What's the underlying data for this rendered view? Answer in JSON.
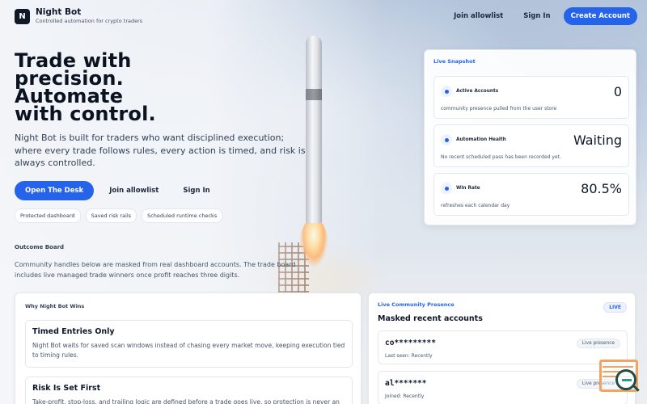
{
  "header": {
    "logo_glyph": "N",
    "brand_name": "Night Bot",
    "tagline": "Controlled automation for crypto traders",
    "nav_allowlist": "Join allowlist",
    "nav_signin": "Sign In",
    "create_account": "Create Account"
  },
  "hero": {
    "title_line1": "Trade with",
    "title_line2": "precision.",
    "title_line3": "Automate",
    "title_line4": "with control.",
    "subtitle": "Night Bot is built for traders who want disciplined execution; where every trade follows rules, every action is timed, and risk is always controlled.",
    "cta_primary": "Open The Desk",
    "cta_allowlist": "Join allowlist",
    "cta_signin": "Sign In",
    "chips": [
      "Protected dashboard",
      "Saved risk rails",
      "Scheduled runtime checks"
    ]
  },
  "outcome": {
    "label": "Outcome Board",
    "description": "Community handles below are masked from real dashboard accounts. The trade board includes live managed trade winners once profit reaches three digits."
  },
  "snapshot": {
    "title": "Live Snapshot",
    "metrics": [
      {
        "label": "Active Accounts",
        "value": "0",
        "note": "community presence pulled from the user store"
      },
      {
        "label": "Automation Health",
        "value": "Waiting",
        "note": "No recent scheduled pass has been recorded yet."
      },
      {
        "label": "Win Rate",
        "value": "80.5%",
        "note": "refreshes each calendar day"
      }
    ]
  },
  "why": {
    "title": "Why Night Bot Wins",
    "reasons": [
      {
        "title": "Timed Entries Only",
        "text": "Night Bot waits for saved scan windows instead of chasing every market move, keeping execution tied to timing rules."
      },
      {
        "title": "Risk Is Set First",
        "text": "Take-profit, stop-loss, and trailing logic are defined before a trade goes live, so protection is never an"
      }
    ]
  },
  "live": {
    "title": "Live Community Presence",
    "badge": "LIVE",
    "subtitle": "Masked recent accounts",
    "accounts": [
      {
        "handle": "co*********",
        "meta": "Last seen: Recently",
        "tag": "Live presence"
      },
      {
        "handle": "al*******",
        "meta": "Joined: Recently",
        "tag": "Live presence"
      }
    ]
  },
  "colors": {
    "accent": "#2563eb",
    "text": "#0f172a",
    "muted": "#475569"
  },
  "icons": [
    "night-bot-logo",
    "status-dot-icon",
    "help-search-icon"
  ]
}
